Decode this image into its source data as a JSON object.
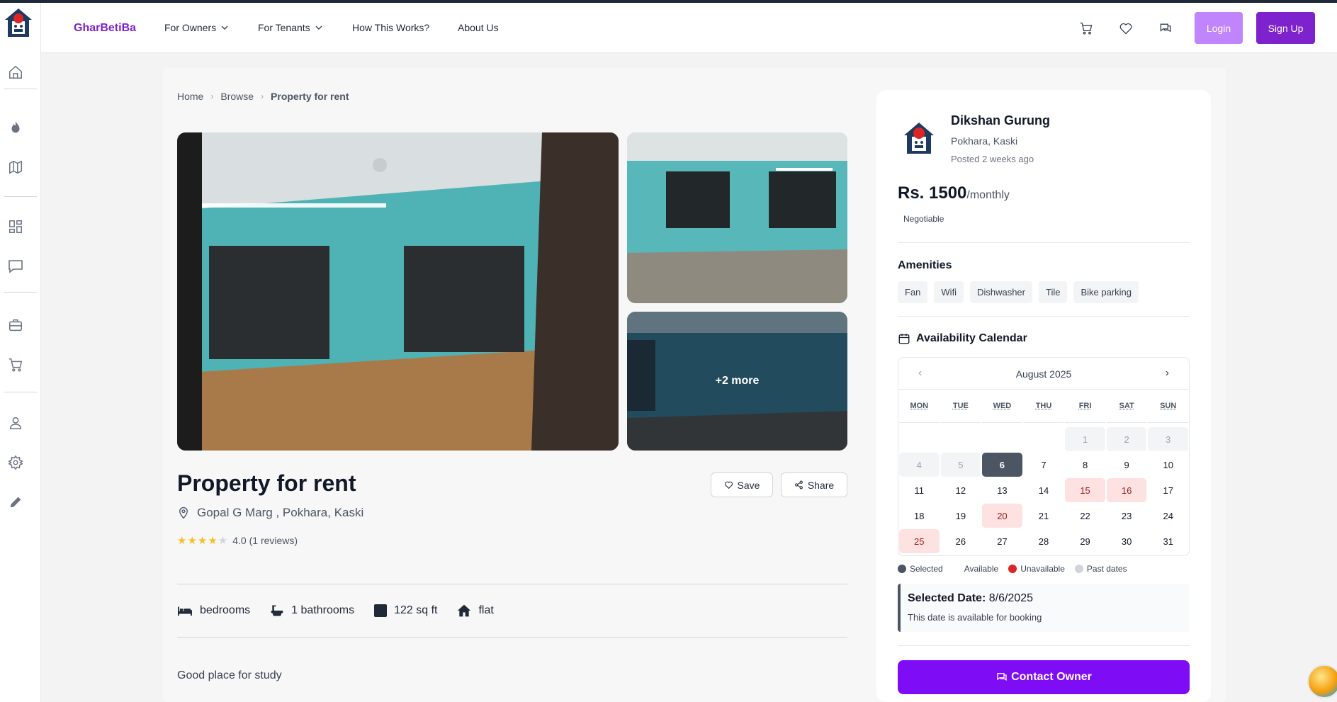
{
  "app": {
    "brand": "GharBetiBa"
  },
  "nav": {
    "items": [
      {
        "label": "For Owners",
        "dropdown": true
      },
      {
        "label": "For Tenants",
        "dropdown": true
      },
      {
        "label": "How This Works?",
        "dropdown": false
      },
      {
        "label": "About Us",
        "dropdown": false
      }
    ],
    "login_label": "Login",
    "signup_label": "Sign Up"
  },
  "breadcrumb": [
    "Home",
    "Browse",
    "Property for rent"
  ],
  "gallery": {
    "more_label": "+2 more"
  },
  "property": {
    "title": "Property for rent",
    "location": "Gopal G Marg , Pokhara, Kaski",
    "rating_value": 4,
    "rating_text": "4.0 (1 reviews)",
    "save_label": "Save",
    "share_label": "Share",
    "features": [
      {
        "icon": "bed-icon",
        "label": "bedrooms"
      },
      {
        "icon": "bath-icon",
        "label": "1 bathrooms"
      },
      {
        "icon": "area-icon",
        "label": "122 sq ft"
      },
      {
        "icon": "home-icon",
        "label": "flat"
      }
    ],
    "description": "Good place for study"
  },
  "owner": {
    "name": "Dikshan Gurung",
    "location": "Pokhara, Kaski",
    "posted": "Posted 2 weeks ago",
    "price": "Rs. 1500",
    "price_period": "/monthly",
    "negotiable": "Negotiable"
  },
  "amenities": {
    "title": "Amenities",
    "items": [
      "Fan",
      "Wifi",
      "Dishwasher",
      "Tile",
      "Bike parking"
    ]
  },
  "calendar": {
    "title": "Availability Calendar",
    "month": "August 2025",
    "weekdays": [
      "MON",
      "TUE",
      "WED",
      "THU",
      "FRI",
      "SAT",
      "SUN"
    ],
    "lead_blanks": 4,
    "days_in_month": 31,
    "past": [
      1,
      2,
      3,
      4,
      5
    ],
    "selected": 6,
    "unavailable": [
      15,
      16,
      20,
      25
    ],
    "legend": [
      "Selected",
      "Available",
      "Unavailable",
      "Past dates"
    ]
  },
  "selection": {
    "label": "Selected Date:",
    "date": "8/6/2025",
    "note": "This date is available for booking"
  },
  "contact_label": "Contact Owner",
  "colors": {
    "brand": "#7e22ce",
    "contact": "#7e0cf5",
    "selected": "#4b5563",
    "unavailable": "#dc2626"
  }
}
